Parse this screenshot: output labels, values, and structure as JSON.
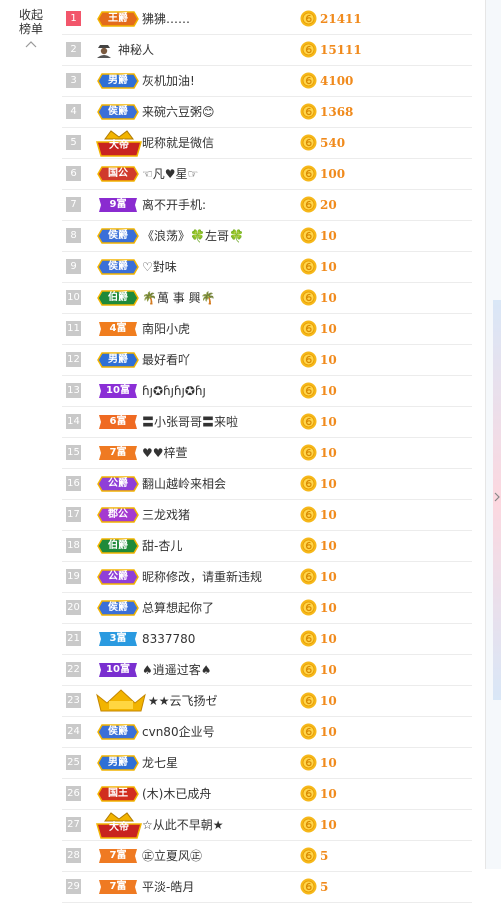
{
  "sidebar": {
    "collapse_label": "收起榜单"
  },
  "rows": [
    {
      "rank": "1",
      "badge": "王爵",
      "badge_type": "wang",
      "name": "狒狒……",
      "score": "21411"
    },
    {
      "rank": "2",
      "badge": "",
      "badge_type": "mystery",
      "name": "神秘人",
      "score": "15111"
    },
    {
      "rank": "3",
      "badge": "男爵",
      "badge_type": "nan",
      "name": "灰机加油!",
      "score": "4100"
    },
    {
      "rank": "4",
      "badge": "侯爵",
      "badge_type": "hou",
      "name": "来碗六豆粥😊",
      "score": "1368"
    },
    {
      "rank": "5",
      "badge": "大帝",
      "badge_type": "dadi",
      "name": "昵称就是微信",
      "score": "540"
    },
    {
      "rank": "6",
      "badge": "国公",
      "badge_type": "guogong",
      "name": "☜凡♥星☞",
      "score": "100"
    },
    {
      "rank": "7",
      "badge": "9富",
      "badge_type": "fu9",
      "name": "离不开手机:",
      "score": "20"
    },
    {
      "rank": "8",
      "badge": "侯爵",
      "badge_type": "hou",
      "name": "《浪荡》🍀左哥🍀",
      "score": "10"
    },
    {
      "rank": "9",
      "badge": "侯爵",
      "badge_type": "hou",
      "name": "♡對味",
      "score": "10"
    },
    {
      "rank": "10",
      "badge": "伯爵",
      "badge_type": "bo",
      "name": "🌴萬 事 興🌴",
      "score": "10"
    },
    {
      "rank": "11",
      "badge": "4富",
      "badge_type": "fu4",
      "name": "南阳小虎",
      "score": "10"
    },
    {
      "rank": "12",
      "badge": "男爵",
      "badge_type": "nan",
      "name": "最好看吖",
      "score": "10"
    },
    {
      "rank": "13",
      "badge": "10富",
      "badge_type": "fu10",
      "name": "ɦȷ✪ɦȷɦȷ✪ɦȷ",
      "score": "10"
    },
    {
      "rank": "14",
      "badge": "6富",
      "badge_type": "fu6",
      "name": "〓小张哥哥〓来啦",
      "score": "10"
    },
    {
      "rank": "15",
      "badge": "7富",
      "badge_type": "fu7",
      "name": "♥♥梓萱",
      "score": "10"
    },
    {
      "rank": "16",
      "badge": "公爵",
      "badge_type": "gong",
      "name": "翻山越岭来相会",
      "score": "10"
    },
    {
      "rank": "17",
      "badge": "郡公",
      "badge_type": "jungong",
      "name": "三龙戏猪",
      "score": "10"
    },
    {
      "rank": "18",
      "badge": "伯爵",
      "badge_type": "bo",
      "name": "甜-杏儿",
      "score": "10"
    },
    {
      "rank": "19",
      "badge": "公爵",
      "badge_type": "gong",
      "name": "昵称修改，请重新违规",
      "score": "10"
    },
    {
      "rank": "20",
      "badge": "侯爵",
      "badge_type": "hou",
      "name": "总算想起你了",
      "score": "10"
    },
    {
      "rank": "21",
      "badge": "3富",
      "badge_type": "fu3",
      "name": "8337780",
      "score": "10"
    },
    {
      "rank": "22",
      "badge": "10富",
      "badge_type": "fu10b",
      "name": "♠逍遥过客♠",
      "score": "10"
    },
    {
      "rank": "23",
      "badge": "",
      "badge_type": "crown",
      "name": "★★云飞扬ゼ",
      "score": "10"
    },
    {
      "rank": "24",
      "badge": "侯爵",
      "badge_type": "hou",
      "name": "cvn80企业号",
      "score": "10"
    },
    {
      "rank": "25",
      "badge": "男爵",
      "badge_type": "nan",
      "name": "龙七星",
      "score": "10"
    },
    {
      "rank": "26",
      "badge": "国王",
      "badge_type": "guowang",
      "name": "(木)木已成舟",
      "score": "10"
    },
    {
      "rank": "27",
      "badge": "大帝",
      "badge_type": "dadi",
      "name": "☆从此不早朝★",
      "score": "10"
    },
    {
      "rank": "28",
      "badge": "7富",
      "badge_type": "fu7",
      "name": "㊣立夏风㊣",
      "score": "5"
    },
    {
      "rank": "29",
      "badge": "7富",
      "badge_type": "fu7",
      "name": "平淡-皓月",
      "score": "5"
    }
  ],
  "colors": {
    "wang": "#e36b1b",
    "nan": "#2f6fd6",
    "hou": "#3a6fd8",
    "dadi": "#c8231f",
    "guogong": "#d03a2c",
    "fu9": "#8a2bd0",
    "bo": "#1f8a3a",
    "fu4": "#f07d1e",
    "fu10": "#8b2fd6",
    "fu6": "#ef6a22",
    "fu7": "#ef7a22",
    "gong": "#8f3fd8",
    "jungong": "#a43ad0",
    "fu3": "#2a9ae0",
    "fu10b": "#7a2fd0",
    "guowang": "#d12e1e",
    "score": "#f08a1c",
    "rank_first": "#f2566b",
    "rank_other": "#c9c9c9"
  },
  "icons": {
    "coin": "gold-coin-icon",
    "collapse": "chevron-up-icon",
    "mystery": "mystery-person-icon",
    "crown": "golden-crown-badge-icon",
    "right_arrow": "chevron-right-icon"
  }
}
